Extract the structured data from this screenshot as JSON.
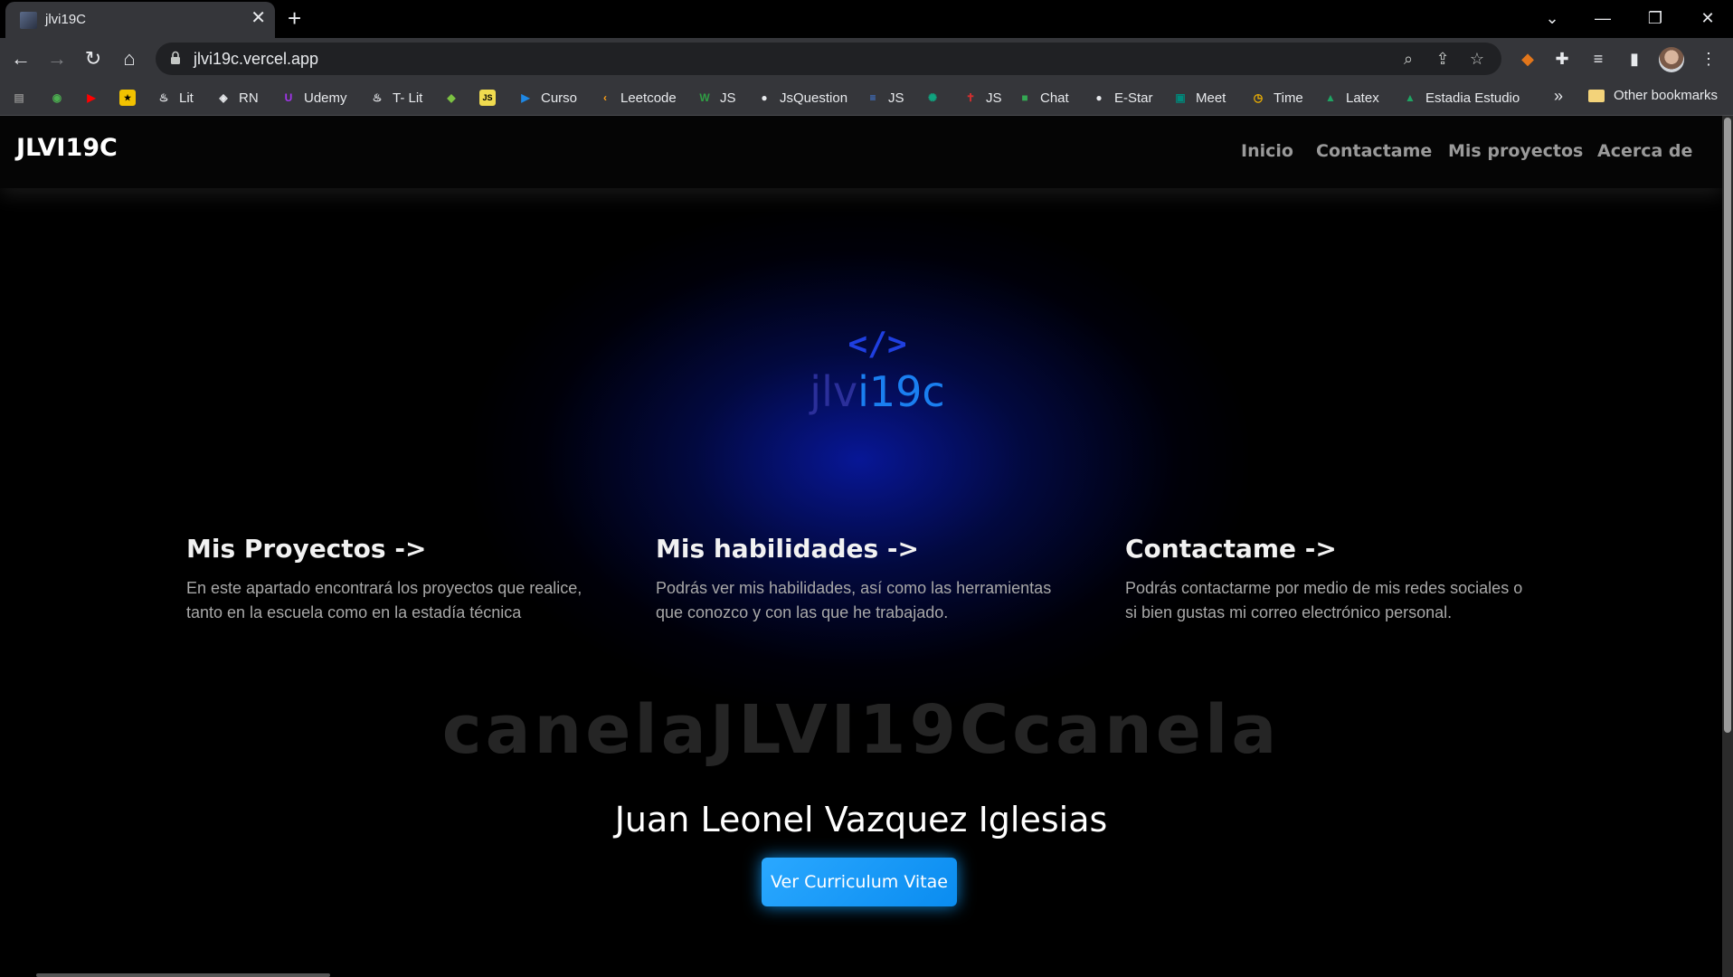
{
  "browser": {
    "tab_title": "jlvi19C",
    "url": "jlvi19c.vercel.app",
    "bookmarks": [
      {
        "label": "",
        "icon": "bookmark-app-icon",
        "color": "#888888"
      },
      {
        "label": "",
        "icon": "bookmark-chrome-icon",
        "color": "#4caf50"
      },
      {
        "label": "",
        "icon": "youtube-icon",
        "color": "#ff0000"
      },
      {
        "label": "",
        "icon": "bookmark-yellow-icon",
        "color": "#f2c200"
      },
      {
        "label": "Lit",
        "icon": "fire-icon",
        "color": "#e8eaed"
      },
      {
        "label": "RN",
        "icon": "react-native-icon",
        "color": "#e8eaed"
      },
      {
        "label": "Udemy",
        "icon": "udemy-icon",
        "color": "#a435f0"
      },
      {
        "label": "T- Lit",
        "icon": "fire-icon",
        "color": "#e8eaed"
      },
      {
        "label": "",
        "icon": "bookmark-green-icon",
        "color": "#7cc242"
      },
      {
        "label": "",
        "icon": "js-icon",
        "color": "#f0db4f"
      },
      {
        "label": "Curso",
        "icon": "play-icon",
        "color": "#1e88e5"
      },
      {
        "label": "Leetcode",
        "icon": "leetcode-icon",
        "color": "#ffa116"
      },
      {
        "label": "JS",
        "icon": "w-icon",
        "color": "#2f9e44"
      },
      {
        "label": "JsQuestion",
        "icon": "github-icon",
        "color": "#e8eaed"
      },
      {
        "label": "JS",
        "icon": "docs-icon",
        "color": "#4285f4"
      },
      {
        "label": "",
        "icon": "openai-icon",
        "color": "#10a37f"
      },
      {
        "label": "JS",
        "icon": "figure-icon",
        "color": "#d32f2f"
      },
      {
        "label": "Chat",
        "icon": "chat-icon",
        "color": "#34a853"
      },
      {
        "label": "E-Star",
        "icon": "github-icon",
        "color": "#e8eaed"
      },
      {
        "label": "Meet",
        "icon": "meet-icon",
        "color": "#00897b"
      },
      {
        "label": "Time",
        "icon": "clock-icon",
        "color": "#f4b400"
      },
      {
        "label": "Latex",
        "icon": "drive-icon",
        "color": "#1fa463"
      },
      {
        "label": "Estadia Estudio",
        "icon": "drive-icon",
        "color": "#1fa463"
      }
    ],
    "more_label": "»",
    "other_bookmarks": "Other bookmarks"
  },
  "site": {
    "brand": "JLVI19C",
    "nav": [
      "Inicio",
      "Contactame",
      "Mis proyectos",
      "Acerca de"
    ],
    "logo_code": "</>",
    "logo_dim": "jlv",
    "logo_bright": "i19c",
    "cards": [
      {
        "title": "Mis Proyectos ->",
        "text": "En este apartado encontrará los proyectos que realice, tanto en la escuela como en la estadía técnica"
      },
      {
        "title": "Mis habilidades ->",
        "text": "Podrás ver mis habilidades, así como las herramientas que conozco y con las que he trabajado."
      },
      {
        "title": "Contactame ->",
        "text": "Podrás contactarme por medio de mis redes sociales o si bien gustas mi correo electrónico personal."
      }
    ],
    "marquee": "canelaJLVI19Ccanela",
    "full_name": "Juan Leonel Vazquez Iglesias",
    "cv_button": "Ver Curriculum Vitae"
  }
}
